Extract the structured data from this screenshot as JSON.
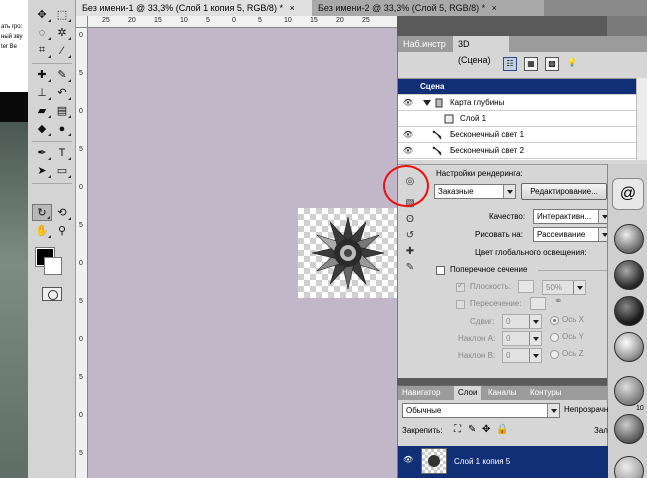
{
  "left_window": {
    "lines": [
      "ать гро:",
      "ный зву",
      "ter Be"
    ]
  },
  "doc_tabs": [
    {
      "title": "Без имени-1 @ 33,3% (Слой 1 копия 5, RGB/8) *",
      "close": "×"
    },
    {
      "title": "Без имени-2 @ 33,3% (Слой 5, RGB/8) *",
      "close": "×"
    }
  ],
  "ruler_top": [
    "25",
    "20",
    "15",
    "10",
    "5",
    "0",
    "5",
    "10",
    "15",
    "20",
    "25"
  ],
  "ruler_left": [
    "0",
    "5",
    "0",
    "5",
    "0",
    "5",
    "0",
    "5",
    "0",
    "5",
    "0",
    "5"
  ],
  "panel3d": {
    "tabs": [
      "Наб.инстр",
      "3D (Сцена)"
    ],
    "scene": [
      {
        "label": "Сцена",
        "eye": ""
      },
      {
        "label": "Карта глубины",
        "eye": "👁"
      },
      {
        "label": "Слой 1",
        "eye": ""
      },
      {
        "label": "Бесконечный свет 1",
        "eye": "👁"
      },
      {
        "label": "Бесконечный свет 2",
        "eye": "👁"
      }
    ],
    "render_settings_label": "Настройки рендеринга:",
    "preset_value": "Заказные",
    "edit_button": "Редактирование...",
    "quality_label": "Качество:",
    "quality_value": "Интерактивн...",
    "paint_on_label": "Рисовать на:",
    "paint_on_value": "Рассеивание",
    "global_ambient_label": "Цвет глобального освещения:",
    "cross_section_label": "Поперечное сечение",
    "plane_label": "Плоскость:",
    "plane_value": "50%",
    "intersection_label": "Пересечение:",
    "offset_label": "Сдвиг:",
    "offset_value": "0",
    "tilt_a_label": "Наклон А:",
    "tilt_a_value": "0",
    "tilt_b_label": "Наклон B:",
    "tilt_b_value": "0",
    "axis_x": "Ось X",
    "axis_y": "Ось Y",
    "axis_z": "Ось Z"
  },
  "presets_icon": "@",
  "layers_panel": {
    "tabs": [
      "Навигатор",
      "Слои",
      "Каналы",
      "Контуры"
    ],
    "blend_mode": "Обычные",
    "opacity_label": "Непрозрачн",
    "lock_label": "Закрепить:",
    "fill_label": "Зал",
    "layer_name": "Слой 1 копия 5",
    "layer_eye": "👁",
    "fill_value": "10"
  },
  "colors": {
    "canvas": "#c2b7c9",
    "selection_blue": "#102f77",
    "annotation_red": "#e11111"
  }
}
